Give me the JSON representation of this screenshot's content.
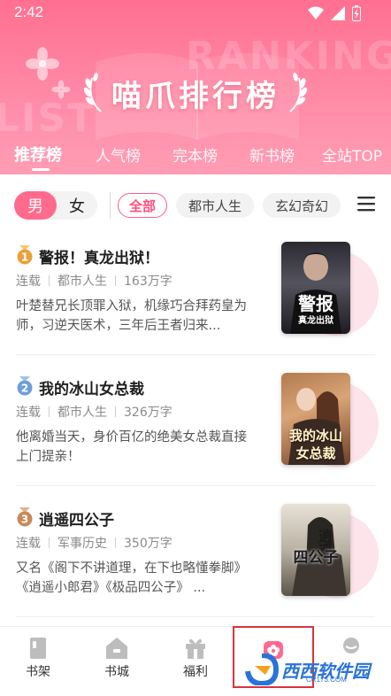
{
  "status_bar": {
    "time": "2:42",
    "icons": [
      "wifi-icon",
      "signal-icon",
      "battery-charging-icon"
    ]
  },
  "header": {
    "title": "喵爪排行榜",
    "watermark_words": [
      "RANKING",
      "LIST"
    ],
    "tabs": [
      {
        "label": "推荐榜",
        "active": true
      },
      {
        "label": "人气榜",
        "active": false
      },
      {
        "label": "完本榜",
        "active": false
      },
      {
        "label": "新书榜",
        "active": false
      },
      {
        "label": "全站TOP",
        "active": false
      }
    ]
  },
  "filters": {
    "gender": {
      "male": "男",
      "female": "女",
      "selected": "男"
    },
    "chips": [
      {
        "label": "全部",
        "active": true
      },
      {
        "label": "都市人生",
        "active": false
      },
      {
        "label": "玄幻奇幻",
        "active": false
      }
    ],
    "menu_icon": "hamburger-menu-icon"
  },
  "books": [
    {
      "rank": "1",
      "rank_color": "#e8a23a",
      "title": "警报！真龙出狱！",
      "status": "连载",
      "category": "都市人生",
      "word_count": "163万字",
      "description": "叶楚替兄长顶罪入狱，机缘巧合拜药皇为师，习逆天医术，三年后王者归来...",
      "cover_text": [
        "警报",
        "真龙出狱"
      ]
    },
    {
      "rank": "2",
      "rank_color": "#6f9fd6",
      "title": "我的冰山女总裁",
      "status": "连载",
      "category": "都市人生",
      "word_count": "326万字",
      "description": "他离婚当天，身价百亿的绝美女总裁直接上门提亲！",
      "cover_text": [
        "我的冰山",
        "女总裁"
      ]
    },
    {
      "rank": "3",
      "rank_color": "#c98a5a",
      "title": "逍遥四公子",
      "status": "连载",
      "category": "军事历史",
      "word_count": "350万字",
      "description": "又名《阁下不讲道理，在下也略懂拳脚》《逍遥小郎君》《极品四公子》 ...",
      "cover_text": [
        "逍遥",
        "四公子"
      ]
    }
  ],
  "bottom_nav": [
    {
      "label": "书架",
      "icon": "bookshelf-icon",
      "active": false
    },
    {
      "label": "书城",
      "icon": "home-icon",
      "active": false
    },
    {
      "label": "福利",
      "icon": "gift-icon",
      "active": false
    },
    {
      "label": "",
      "icon": "ranking-flower-icon",
      "active": true
    },
    {
      "label": "",
      "icon": "profile-icon",
      "active": false
    }
  ],
  "watermark": {
    "text": "西西软件园",
    "sub": "CR173.COM"
  },
  "colors": {
    "brand_pink": "#ff6a8d",
    "header_top": "#ff6f91",
    "active_chip": "#ff4f7d",
    "highlight_box": "#d9343c"
  }
}
